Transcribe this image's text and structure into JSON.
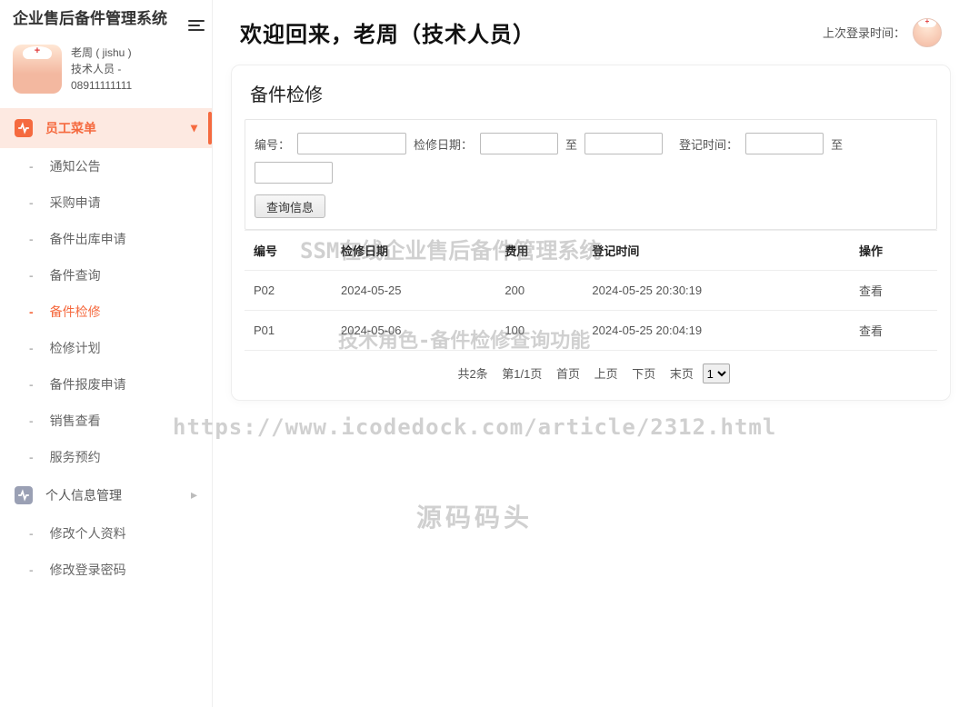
{
  "brand": "企业售后备件管理系统",
  "user": {
    "name_line": "老周 ( jishu )",
    "role_line": "技术人员 -",
    "phone": "08911111111"
  },
  "sidebar": {
    "group1": {
      "label": "员工菜单",
      "items": [
        {
          "label": "通知公告",
          "name": "sidebar-item-notice"
        },
        {
          "label": "采购申请",
          "name": "sidebar-item-purchase"
        },
        {
          "label": "备件出库申请",
          "name": "sidebar-item-out-apply"
        },
        {
          "label": "备件查询",
          "name": "sidebar-item-part-query"
        },
        {
          "label": "备件检修",
          "name": "sidebar-item-part-repair"
        },
        {
          "label": "检修计划",
          "name": "sidebar-item-repair-plan"
        },
        {
          "label": "备件报废申请",
          "name": "sidebar-item-scrap-apply"
        },
        {
          "label": "销售查看",
          "name": "sidebar-item-sales-view"
        },
        {
          "label": "服务预约",
          "name": "sidebar-item-service-book"
        }
      ]
    },
    "group2": {
      "label": "个人信息管理",
      "items": [
        {
          "label": "修改个人资料",
          "name": "sidebar-item-edit-profile"
        },
        {
          "label": "修改登录密码",
          "name": "sidebar-item-edit-password"
        }
      ]
    }
  },
  "topbar": {
    "welcome": "欢迎回来，老周（技术人员）",
    "last_login_label": "上次登录时间："
  },
  "card": {
    "title": "备件检修",
    "filters": {
      "code_label": "编号：",
      "repair_date_label": "检修日期：",
      "to": "至",
      "register_time_label": "登记时间：",
      "query_btn": "查询信息"
    },
    "table": {
      "headers": {
        "code": "编号",
        "repair_date": "检修日期",
        "cost": "费用",
        "register_time": "登记时间",
        "action": "操作"
      },
      "rows": [
        {
          "code": "P02",
          "repair_date": "2024-05-25",
          "cost": "200",
          "register_time": "2024-05-25 20:30:19",
          "action": "查看"
        },
        {
          "code": "P01",
          "repair_date": "2024-05-06",
          "cost": "100",
          "register_time": "2024-05-25 20:04:19",
          "action": "查看"
        }
      ]
    },
    "pagination": {
      "total_text": "共2条",
      "page_text": "第1/1页",
      "first": "首页",
      "prev": "上页",
      "next": "下页",
      "last": "末页",
      "page_select": "1"
    }
  },
  "watermarks": {
    "wm1": "SSM在线企业售后备件管理系统",
    "wm2": "技术角色-备件检修查询功能",
    "wm3": "https://www.icodedock.com/article/2312.html",
    "wm4": "源码码头"
  }
}
